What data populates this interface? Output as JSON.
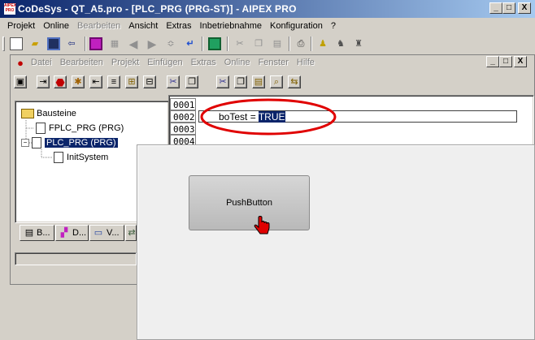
{
  "window": {
    "title": "CoDeSys - QT_A5.pro - [PLC_PRG (PRG-ST)] - AIPEX PRO",
    "icon_text": "AIPEX PRO",
    "controls": [
      "_",
      "□",
      "X"
    ]
  },
  "main_menu": [
    {
      "label": "Projekt",
      "disabled": false
    },
    {
      "label": "Online",
      "disabled": false
    },
    {
      "label": "Bearbeiten",
      "disabled": true
    },
    {
      "label": "Ansicht",
      "disabled": false
    },
    {
      "label": "Extras",
      "disabled": false
    },
    {
      "label": "Inbetriebnahme",
      "disabled": false
    },
    {
      "label": "Konfiguration",
      "disabled": false
    },
    {
      "label": "?",
      "disabled": false
    }
  ],
  "inner_menu": [
    "Datei",
    "Bearbeiten",
    "Projekt",
    "Einfügen",
    "Extras",
    "Online",
    "Fenster",
    "Hilfe"
  ],
  "inner_controls": [
    "_",
    "□",
    "X"
  ],
  "tree": {
    "root": "Bausteine",
    "items": [
      {
        "label": "FPLC_PRG (PRG)",
        "selected": false
      },
      {
        "label": "PLC_PRG (PRG)",
        "selected": true
      },
      {
        "label": "InitSystem",
        "selected": false
      }
    ]
  },
  "tabs": [
    {
      "label": "B..."
    },
    {
      "label": "D..."
    },
    {
      "label": "V..."
    }
  ],
  "editor": {
    "line_numbers": [
      "0001",
      "0002",
      "0003",
      "0004"
    ],
    "code_prefix": "boTest = ",
    "code_selected": "TRUE"
  },
  "overlay": {
    "button_label": "PushButton"
  },
  "colors": {
    "title_start": "#0a246a",
    "title_end": "#a6caf0",
    "selection": "#0a246a",
    "annotation": "#e00000"
  }
}
